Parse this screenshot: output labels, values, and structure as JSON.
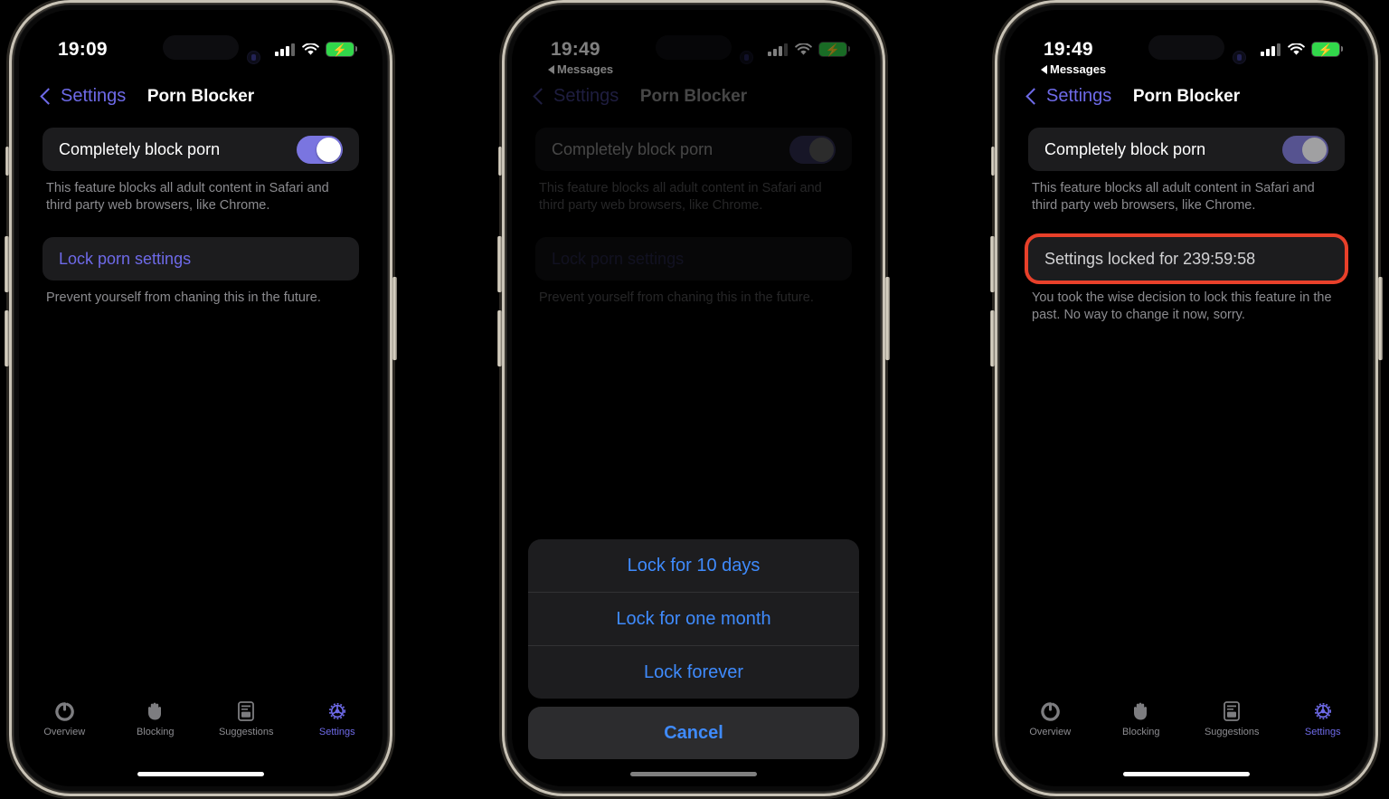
{
  "app": {
    "nav_back_label": "Settings",
    "nav_title": "Porn Blocker",
    "block_row_label": "Completely block porn",
    "block_footnote": "This feature blocks all adult content in Safari and third party web browsers, like Chrome.",
    "lock_row_label": "Lock porn settings",
    "lock_footnote": "Prevent yourself from chaning this in the future.",
    "locked_row_label": "Settings locked for 239:59:58",
    "locked_footnote": "You took the wise decision to lock this feature in the past. No way to change it now, sorry."
  },
  "tabs": [
    {
      "label": "Overview",
      "icon": "gauge-ring-icon",
      "active": false
    },
    {
      "label": "Blocking",
      "icon": "hand-icon",
      "active": false
    },
    {
      "label": "Suggestions",
      "icon": "document-card-icon",
      "active": false
    },
    {
      "label": "Settings",
      "icon": "gear-icon",
      "active": true
    }
  ],
  "sheet": {
    "options": [
      "Lock for 10 days",
      "Lock for one month",
      "Lock forever"
    ],
    "cancel_label": "Cancel"
  },
  "phones": [
    {
      "id": "phone-left",
      "status": {
        "time": "19:09",
        "back_app": "",
        "signal": "3-of-4-bars",
        "wifi": "wifi-icon",
        "battery": "charging"
      },
      "state": "unlocked"
    },
    {
      "id": "phone-middle",
      "status": {
        "time": "19:49",
        "back_app": "Messages",
        "signal": "3-of-4-bars",
        "wifi": "wifi-icon",
        "battery": "charging"
      },
      "state": "action-sheet"
    },
    {
      "id": "phone-right",
      "status": {
        "time": "19:49",
        "back_app": "Messages",
        "signal": "3-of-4-bars",
        "wifi": "wifi-icon",
        "battery": "charging"
      },
      "state": "locked"
    }
  ],
  "colors": {
    "accent_purple": "#6e6ae8",
    "toggle_on": "#7a75e0",
    "sheet_blue": "#3f8bfd",
    "highlight_red": "#e8402a",
    "card_bg": "#1c1c1e",
    "battery_green": "#32d74b"
  }
}
